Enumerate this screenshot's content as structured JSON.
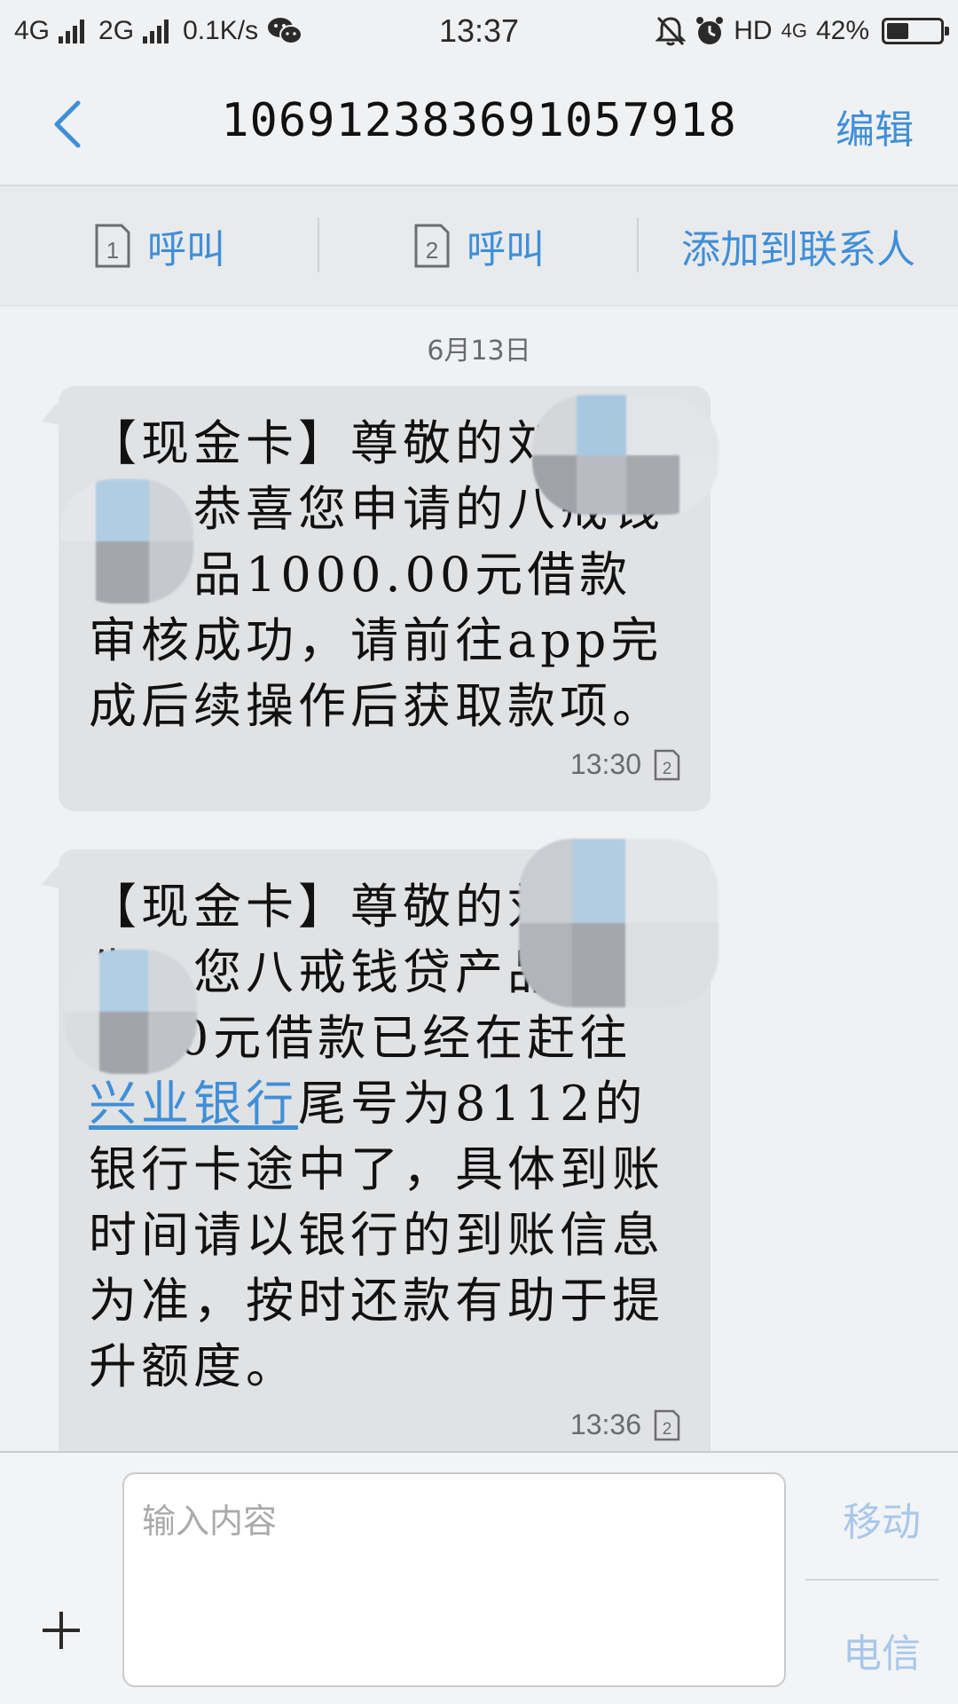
{
  "status_bar": {
    "left_network_1": "4G",
    "left_network_2": "2G",
    "speed": "0.1K/s",
    "time": "13:37",
    "hd": "HD",
    "network_right": "4G",
    "battery": "42%",
    "battery_level": 0.42
  },
  "header": {
    "title": "106912383691057918",
    "edit_label": "编辑"
  },
  "actions": [
    {
      "sim": "1",
      "label": "呼叫"
    },
    {
      "sim": "2",
      "label": "呼叫"
    },
    {
      "label": "添加到联系人"
    }
  ],
  "conversation": {
    "date": "6月13日",
    "messages": [
      {
        "text": "【现金卡】尊敬的刘 先生，恭喜您申请的八戒钱贷产品1000.00元借款审核成功，请前往app完成后续操作后获取款项。",
        "time": "13:30",
        "sim": "2"
      },
      {
        "text_before": "【现金卡】尊敬的刘先生，您八戒钱贷产品1000.00元借款已经在赶往",
        "link": "兴业银行",
        "text_after": "尾号为8112的银行卡途中了，具体到账时间请以银行的到账信息为准，按时还款有助于提升额度。",
        "time": "13:36",
        "sim": "2"
      }
    ]
  },
  "composer": {
    "placeholder": "输入内容",
    "send_sim1": "移动",
    "send_sim2": "电信"
  },
  "colors": {
    "accent": "#3f8fd8",
    "bubble": "#e1e2e4",
    "background": "#f0f1f3"
  }
}
